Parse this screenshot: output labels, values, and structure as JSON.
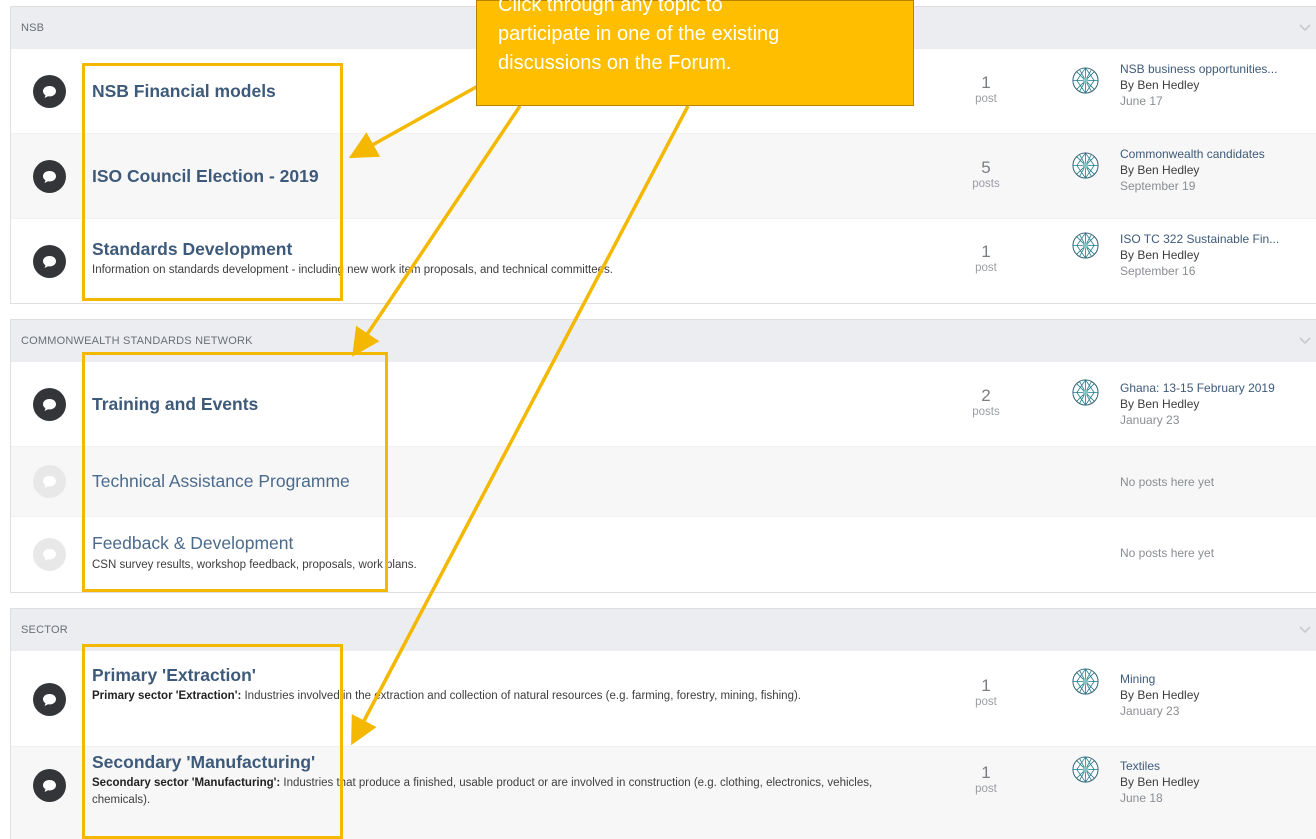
{
  "sections": [
    {
      "header": "NSB",
      "forums": [
        {
          "title": "NSB Financial models",
          "description": "",
          "count": "1",
          "count_label": "post",
          "last_title": "NSB business opportunities...",
          "last_by": "By Ben Hedley",
          "last_date": "June 17"
        },
        {
          "title": "ISO Council Election - 2019",
          "description": "",
          "count": "5",
          "count_label": "posts",
          "last_title": "Commonwealth candidates",
          "last_by": "By Ben Hedley",
          "last_date": "September 19"
        },
        {
          "title": "Standards Development",
          "description": "Information on standards development - including new work item proposals, and technical committees.",
          "count": "1",
          "count_label": "post",
          "last_title": "ISO TC 322 Sustainable Fin...",
          "last_by": "By Ben Hedley",
          "last_date": "September 16"
        }
      ]
    },
    {
      "header": "COMMONWEALTH STANDARDS NETWORK",
      "forums": [
        {
          "title": "Training and Events",
          "description": "",
          "count": "2",
          "count_label": "posts",
          "last_title": "Ghana: 13-15 February 2019",
          "last_by": "By Ben Hedley",
          "last_date": "January 23"
        },
        {
          "title": "Technical Assistance Programme",
          "description": "",
          "no_posts": "No posts here yet"
        },
        {
          "title": "Feedback & Development",
          "description": "CSN survey results, workshop feedback, proposals, work plans.",
          "no_posts": "No posts here yet"
        }
      ]
    },
    {
      "header": "SECTOR",
      "forums": [
        {
          "title": "Primary 'Extraction'",
          "description_bold": "Primary sector 'Extraction':",
          "description": " Industries involved in the extraction and collection of natural resources (e.g. farming, forestry, mining, fishing).",
          "count": "1",
          "count_label": "post",
          "last_title": "Mining",
          "last_by": "By Ben Hedley",
          "last_date": "January 23"
        },
        {
          "title": "Secondary 'Manufacturing'",
          "description_bold": "Secondary sector 'Manufacturing':",
          "description": " Industries that produce a finished, usable product or are involved in construction (e.g. clothing, electronics, vehicles, chemicals).",
          "count": "1",
          "count_label": "post",
          "last_title": "Textiles",
          "last_by": "By Ben Hedley",
          "last_date": "June 18"
        }
      ]
    }
  ],
  "callout": {
    "line1": "Click through any topic to",
    "line2": "participate in one of the existing",
    "line3": "discussions on the Forum."
  },
  "colors": {
    "highlight": "#f5b800",
    "callout_bg": "#ffbf00",
    "link": "#3e5a7a",
    "header_bg": "#ebedf0"
  },
  "icons": {
    "forum": "speech-bubble-icon",
    "chevron": "chevron-down-icon",
    "avatar": "geodesic-globe-icon"
  }
}
